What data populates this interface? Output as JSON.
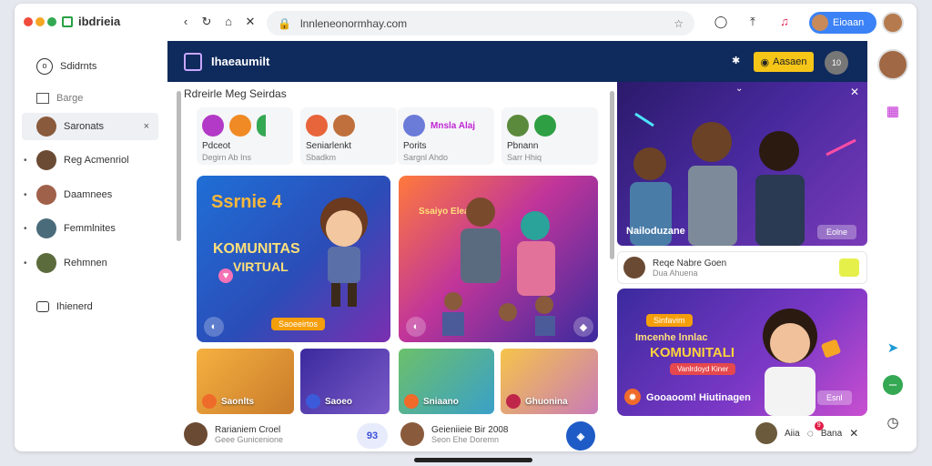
{
  "browser": {
    "app_name": "ibdrieia",
    "url": "lnnleneonormhay.com",
    "user_pill_label": "Eioaan",
    "nav_back": "‹",
    "nav_reload": "↻",
    "nav_home": "⌂",
    "nav_close": "✕"
  },
  "sidebar": {
    "items": [
      {
        "label": "Sdidrnts",
        "icon": "compass-icon"
      },
      {
        "label": "Barge",
        "icon": "home-icon"
      },
      {
        "label": "Saronats",
        "icon": "avatar",
        "active": true
      },
      {
        "label": "Reg Acmenriol",
        "icon": "avatar"
      },
      {
        "label": "Daamnees",
        "icon": "avatar"
      },
      {
        "label": "Femmlnites",
        "icon": "avatar"
      },
      {
        "label": "Rehmnen",
        "icon": "avatar"
      },
      {
        "label": "Ihienerd",
        "icon": "chat-icon"
      }
    ]
  },
  "app": {
    "title": "Ihaeaumilt",
    "premium_label": "Aasaen",
    "header_avatar_label": "10",
    "feed_title": "Rdreirle Meg Seirdas"
  },
  "mini_cards": [
    {
      "title": "Pdceot",
      "sub": "Degirn Ab Ins"
    },
    {
      "title": "Seniarlenkt",
      "sub": "Sbadkm"
    },
    {
      "title": "Porits",
      "sub": "Sargnl Ahdo",
      "overlay": "Mnsla Alaj"
    },
    {
      "title": "Pbnann",
      "sub": "Sarr Hhiq"
    }
  ],
  "feature_cards": [
    {
      "headline_top": "Ssrnie 4",
      "headline_mid": "KOMUNITAS",
      "headline_bot": "VIRTUAL",
      "pill": "Saoeeirtos"
    },
    {
      "overlay": "Ssaiyo Elea"
    }
  ],
  "small_cards": [
    {
      "label": "Saonlts"
    },
    {
      "label": "Saoeo"
    },
    {
      "label": "Sniaano"
    },
    {
      "label": "Ghuonina"
    }
  ],
  "right_panel": {
    "video_title": "Nailoduzane",
    "video_button": "Eolne",
    "comment_title": "Reqe Nabre Goen",
    "comment_sub": "Dua Ahuena",
    "promo_tag": "Sinfavim",
    "promo_line1": "Imcenhe lnnlac",
    "promo_line2": "KOMUNITALI",
    "promo_pill": "Vanlrdoyd Kiner",
    "promo_caption": "Gooaoom! Hiutinagen",
    "promo_button": "Esnl"
  },
  "bottom_bar": {
    "user1_title": "Rarianiem Croel",
    "user1_sub": "Geee Gunicenione",
    "btn1_label": "93",
    "user2_title": "Geieniieie Bir 2008",
    "user2_sub": "Seon Ehe Doremn",
    "user3_name": "Aiia",
    "badge": "9",
    "user3_label": "Bana"
  },
  "colors": {
    "header_bg": "#0f2a5c",
    "premium": "#f5c518",
    "accent_blue": "#1e5bc6",
    "orange": "#f59e0b"
  }
}
